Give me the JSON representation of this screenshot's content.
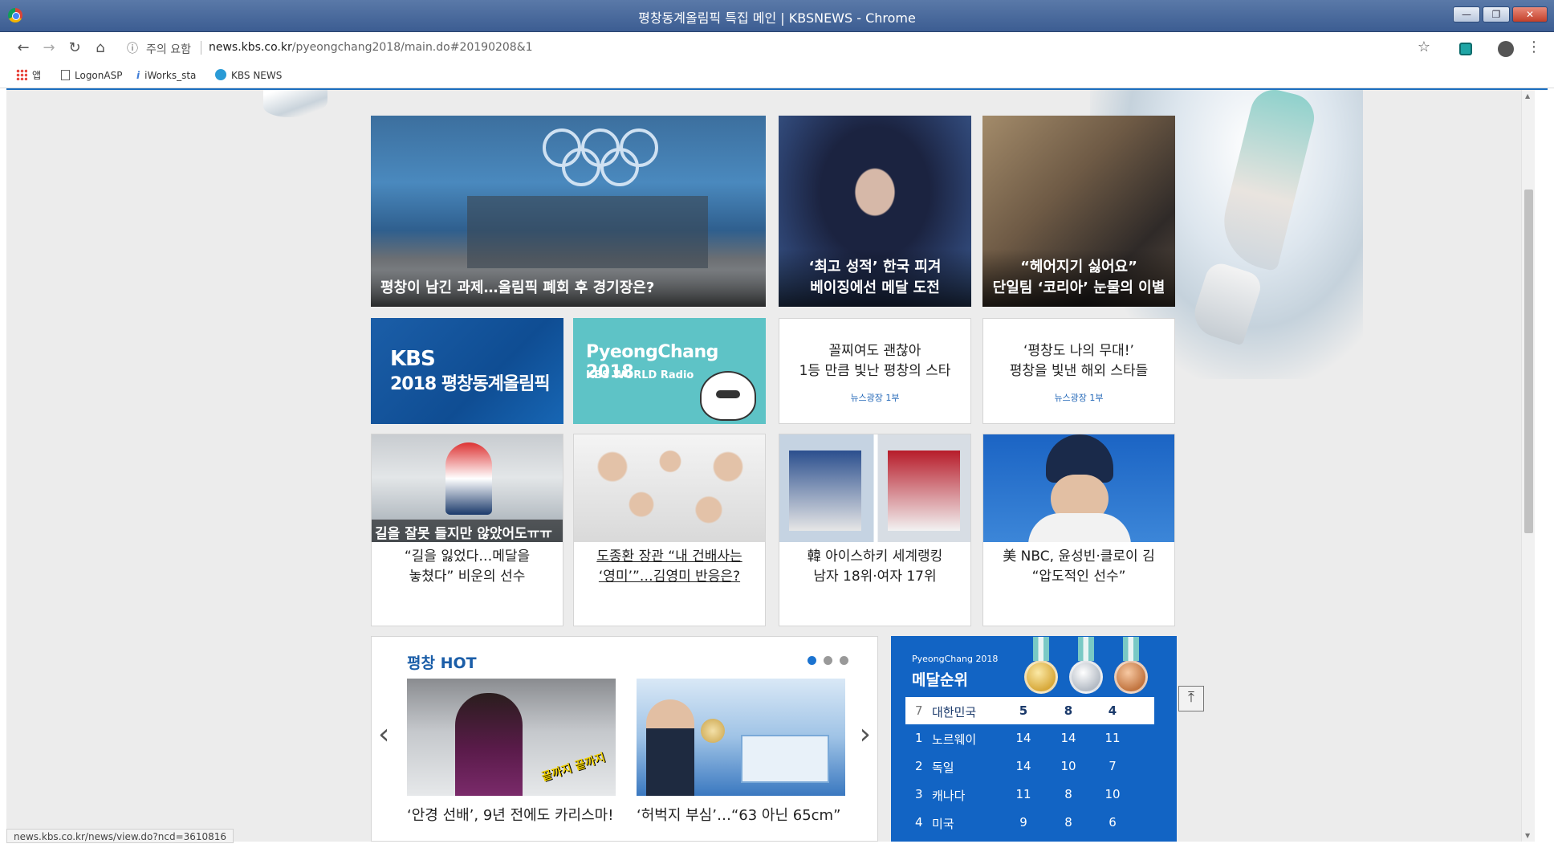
{
  "window": {
    "title": "평창동계올림픽 특집 메인 | KBSNEWS - Chrome"
  },
  "toolbar": {
    "security_label": "주의 요함",
    "url_host": "news.kbs.co.kr",
    "url_path": "/pyeongchang2018/main.do#20190208&1"
  },
  "bookmarks": [
    {
      "label": "앱"
    },
    {
      "label": "LogonASP"
    },
    {
      "label": "iWorks_sta"
    },
    {
      "label": "KBS NEWS"
    }
  ],
  "top_stories": [
    {
      "caption": "평창이 남긴 과제…올림픽 폐회 후 경기장은?"
    },
    {
      "line1": "‘최고 성적’ 한국 피겨",
      "line2": "베이징에선 메달 도전"
    },
    {
      "line1": "“헤어지기 싫어요”",
      "line2": "단일팀 ‘코리아’ 눈물의 이별"
    }
  ],
  "banners": {
    "kbs": {
      "line1": "KBS",
      "line2": "2018 평창동계올림픽"
    },
    "radio": {
      "line1": "PyeongChang 2018",
      "line2": "KBS WORLD Radio"
    }
  },
  "text_cards": [
    {
      "line1": "꼴찌여도 괜찮아",
      "line2": "1등 만큼 빛난 평창의 스타",
      "sub": "뉴스광장 1부"
    },
    {
      "line1": "‘평창도 나의 무대!’",
      "line2": "평창을 빛낸 해외 스타들",
      "sub": "뉴스광장 1부"
    }
  ],
  "news_cards": [
    {
      "overlay": "길을 잘못 들지만 않았어도ㅠㅠ",
      "line1": "“길을 잃었다…메달을",
      "line2": "놓쳤다” 비운의 선수"
    },
    {
      "line1": "도종환 장관 “내 건배사는",
      "line2": "‘영미’”…김영미 반응은?"
    },
    {
      "line1": "韓 아이스하키 세계랭킹",
      "line2": "남자 18위·여자 17위"
    },
    {
      "line1": "美 NBC, 윤성빈·클로이 김",
      "line2": "“압도적인 선수”"
    }
  ],
  "hot": {
    "title": "평창 HOT",
    "items": [
      {
        "caption": "‘안경 선배’, 9년 전에도 카리스마!",
        "overlay": "끝까지 끝까지"
      },
      {
        "caption": "‘허벅지 부심’…“63 아닌 65cm”"
      }
    ]
  },
  "medals": {
    "logo": "PyeongChang 2018",
    "title": "메달순위",
    "rows": [
      {
        "rank": "7",
        "country": "대한민국",
        "gold": "5",
        "silver": "8",
        "bronze": "4"
      },
      {
        "rank": "1",
        "country": "노르웨이",
        "gold": "14",
        "silver": "14",
        "bronze": "11"
      },
      {
        "rank": "2",
        "country": "독일",
        "gold": "14",
        "silver": "10",
        "bronze": "7"
      },
      {
        "rank": "3",
        "country": "캐나다",
        "gold": "11",
        "silver": "8",
        "bronze": "10"
      },
      {
        "rank": "4",
        "country": "미국",
        "gold": "9",
        "silver": "8",
        "bronze": "6"
      }
    ]
  },
  "status": {
    "url": "news.kbs.co.kr/news/view.do?ncd=3610816"
  }
}
